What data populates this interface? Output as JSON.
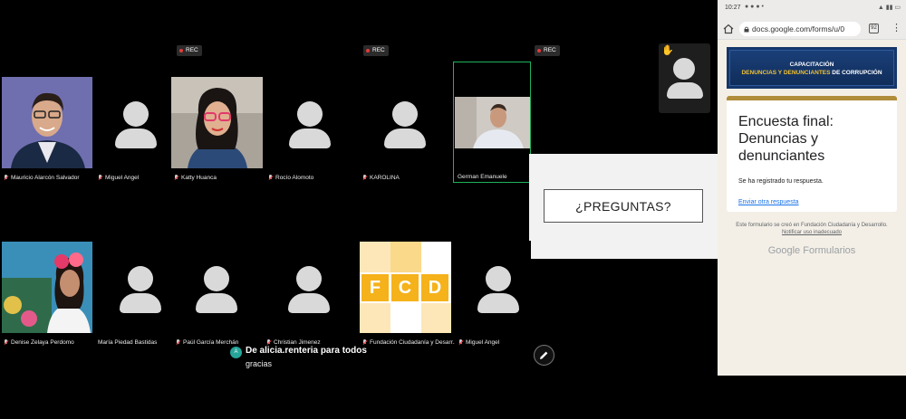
{
  "participants_row1": [
    {
      "name": "Mauricio Alarcón Salvador"
    },
    {
      "name": "Miguel Angel"
    },
    {
      "name": "Katty Huanca"
    },
    {
      "name": "Rocío Alomoto"
    },
    {
      "name": "KAROLINA"
    },
    {
      "name": "German Emanuele"
    }
  ],
  "participants_row2": [
    {
      "name": "Denise Zelaya Perdomo"
    },
    {
      "name": "María Piedad Bastidas"
    },
    {
      "name": "Paúl García Merchán"
    },
    {
      "name": "Christian Jimenez"
    },
    {
      "name": "Fundación Ciudadanía y Desarr..."
    },
    {
      "name": "Miguel Angel"
    }
  ],
  "rec_label": "REC",
  "slide_text": "¿PREGUNTAS?",
  "fcd_logo": {
    "letters": [
      "F",
      "C",
      "D"
    ],
    "color": "#f5b21a"
  },
  "chat": {
    "avatar_initial": "A",
    "from": "De alicia.renteria para todos",
    "message": "gracias"
  },
  "phone": {
    "status_time": "10:27",
    "url": "docs.google.com/forms/u/0",
    "tab_count": "92",
    "banner_top": "CAPACITACIÓN",
    "banner_bottom_highlight": "DENUNCIAS Y DENUNCIANTES",
    "banner_bottom_rest": " DE CORRUPCIÓN",
    "form_title": "Encuesta final: Denuncias y denunciantes",
    "recorded_text": "Se ha registrado tu respuesta.",
    "another_response_link": "Enviar otra respuesta",
    "footer_note": "Este formulario se creó en Fundación Ciudadanía y Desarrollo.",
    "report_link": "Notificar uso inadecuado",
    "google_forms": "Google Formularios"
  },
  "colors": {
    "rec_dot": "#e23b3b",
    "self_border": "#1fb25a",
    "chat_avatar": "#26a69a",
    "banner_bg": "#14366a",
    "banner_highlight": "#f2c230",
    "link": "#1a73e8"
  }
}
